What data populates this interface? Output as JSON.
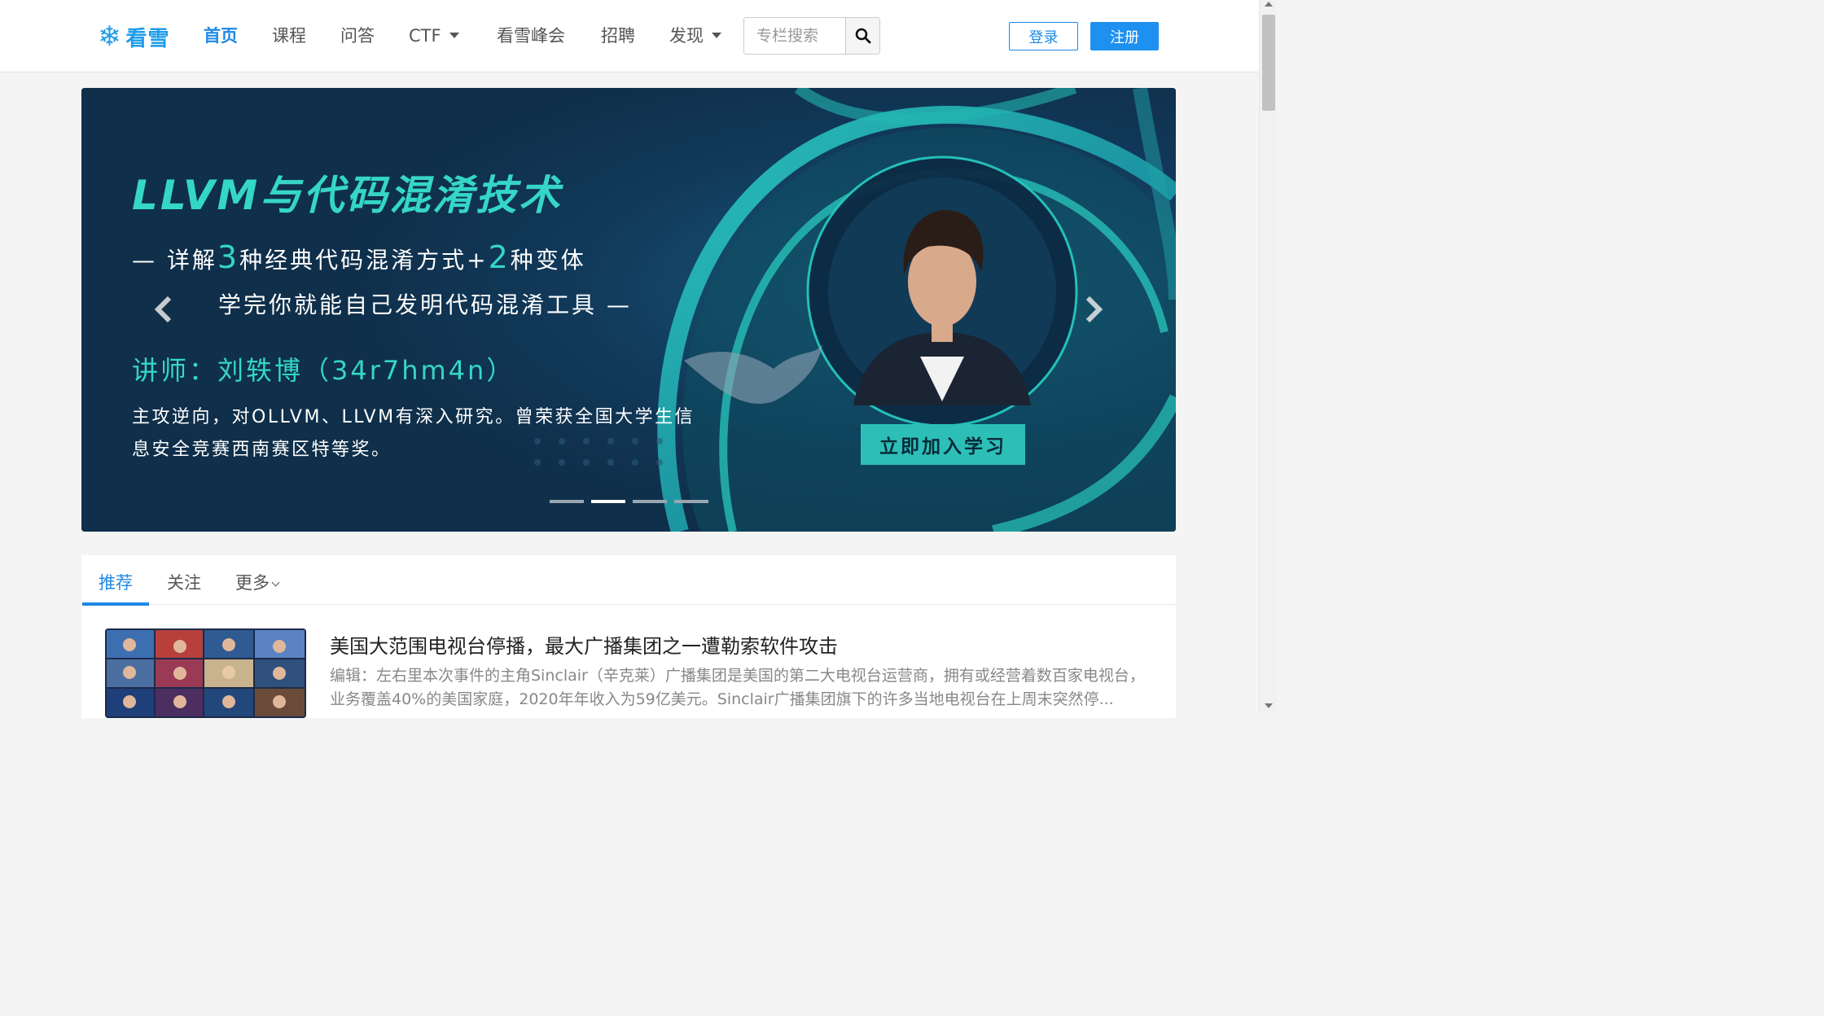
{
  "header": {
    "logo_text": "看雪",
    "nav": [
      {
        "label": "首页",
        "active": true
      },
      {
        "label": "课程"
      },
      {
        "label": "问答"
      },
      {
        "label": "CTF",
        "dropdown": true
      },
      {
        "label": "看雪峰会"
      },
      {
        "label": "招聘"
      },
      {
        "label": "发现",
        "dropdown": true
      }
    ],
    "search_placeholder": "专栏搜索",
    "login_label": "登录",
    "register_label": "注册"
  },
  "banner": {
    "title": "LLVM与代码混淆技术",
    "line1_pre": "— 详解",
    "line1_num1": "3",
    "line1_mid": "种经典代码混淆方式+",
    "line1_num2": "2",
    "line1_post": "种变体",
    "line2": "学完你就能自己发明代码混淆工具 —",
    "teacher": "讲师：刘轶博（34r7hm4n）",
    "description": "主攻逆向，对OLLVM、LLVM有深入研究。曾荣获全国大学生信息安全竞赛西南赛区特等奖。",
    "cta": "立即加入学习",
    "slide_count": 4,
    "active_slide": 2
  },
  "feed": {
    "tabs": [
      "推荐",
      "关注",
      "更多"
    ],
    "active_tab": 0,
    "article": {
      "title": "美国大范围电视台停播，最大广播集团之一遭勒索软件攻击",
      "summary": "编辑：左右里本次事件的主角Sinclair（辛克莱）广播集团是美国的第二大电视台运营商，拥有或经营着数百家电视台，业务覆盖40%的美国家庭，2020年年收入为59亿美元。Sinclair广播集团旗下的许多当地电视台在上周末突然停..."
    }
  },
  "colors": {
    "brand": "#1e88e5",
    "banner_bg": "#0f2f4a",
    "banner_accent": "#35d6c8"
  }
}
